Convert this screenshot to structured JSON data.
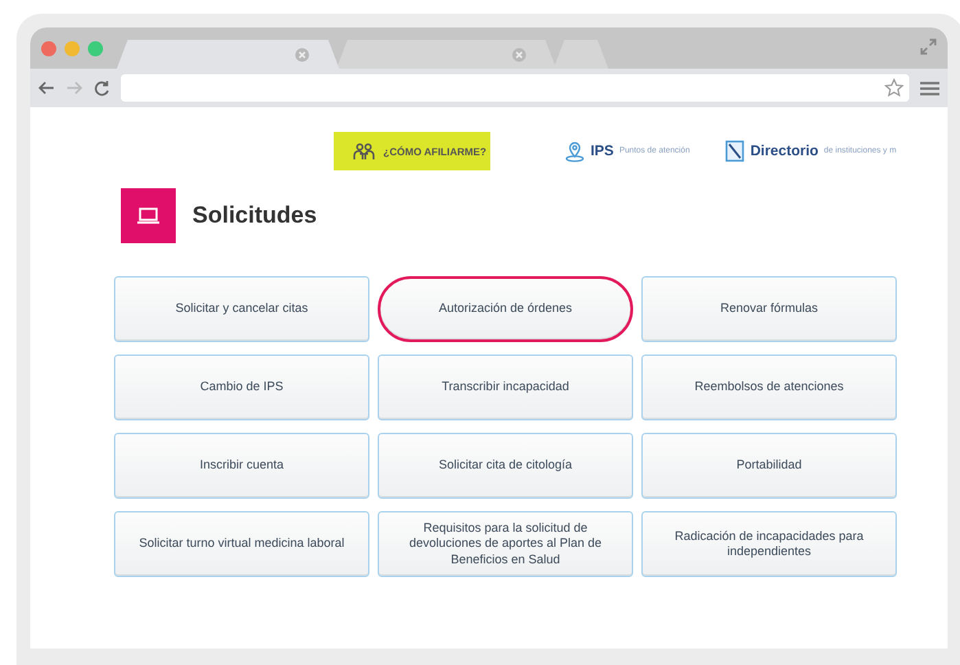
{
  "browser": {
    "tabs": [
      {
        "selected": true
      },
      {
        "selected": false
      },
      {
        "selected": false
      }
    ]
  },
  "top_links": [
    {
      "kind": "button",
      "label": "¿CÓMO AFILIARME?"
    },
    {
      "kind": "pin",
      "title": "IPS",
      "subtitle": "Puntos de atención"
    },
    {
      "kind": "book",
      "title": "Directorio",
      "subtitle": "de instituciones y m"
    }
  ],
  "section": {
    "title": "Solicitudes"
  },
  "requests": [
    {
      "label": "Solicitar y cancelar citas",
      "highlighted": false
    },
    {
      "label": "Autorización de órdenes",
      "highlighted": true
    },
    {
      "label": "Renovar fórmulas",
      "highlighted": false
    },
    {
      "label": "Cambio de IPS",
      "highlighted": false
    },
    {
      "label": "Transcribir incapacidad",
      "highlighted": false
    },
    {
      "label": "Reembolsos de atenciones",
      "highlighted": false
    },
    {
      "label": "Inscribir cuenta",
      "highlighted": false
    },
    {
      "label": "Solicitar cita de citología",
      "highlighted": false
    },
    {
      "label": "Portabilidad",
      "highlighted": false
    },
    {
      "label": "Solicitar turno virtual medicina laboral",
      "highlighted": false
    },
    {
      "label": "Requisitos para la solicitud de devoluciones de aportes al Plan de Beneficios en Salud",
      "highlighted": false
    },
    {
      "label": "Radicación de incapacidades para independientes",
      "highlighted": false
    }
  ]
}
